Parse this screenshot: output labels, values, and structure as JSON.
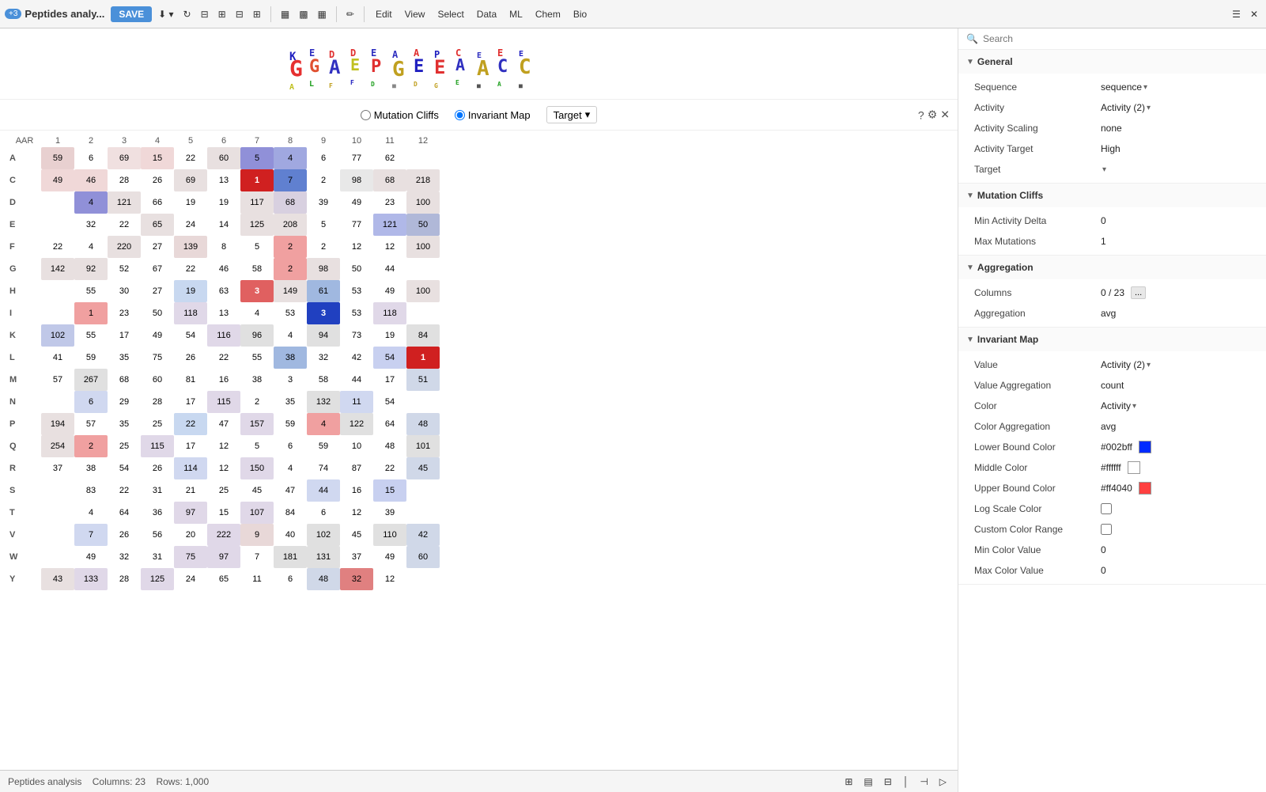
{
  "toolbar": {
    "tab_count": "+3",
    "title": "Peptides analy...",
    "save_label": "SAVE",
    "menus": [
      "Edit",
      "View",
      "Select",
      "Data",
      "ML",
      "Chem",
      "Bio"
    ]
  },
  "controls": {
    "radio_mutation": "Mutation Cliffs",
    "radio_invariant": "Invariant Map",
    "selected": "invariant",
    "target_label": "Target",
    "help_icon": "?",
    "settings_icon": "⚙",
    "close_icon": "✕"
  },
  "heatmap": {
    "col_headers": [
      "AAR",
      "1",
      "2",
      "3",
      "4",
      "5",
      "6",
      "7",
      "8",
      "9",
      "10",
      "11",
      "12"
    ],
    "rows": [
      {
        "label": "A",
        "cells": [
          "59",
          "6",
          "69",
          "15",
          "22",
          "60",
          "5",
          "4",
          "6",
          "77",
          "62",
          ""
        ]
      },
      {
        "label": "C",
        "cells": [
          "49",
          "46",
          "28",
          "26",
          "69",
          "13",
          "1",
          "7",
          "2",
          "98",
          "68",
          "218"
        ]
      },
      {
        "label": "D",
        "cells": [
          "",
          "4",
          "121",
          "66",
          "19",
          "19",
          "117",
          "68",
          "39",
          "49",
          "23",
          "100"
        ]
      },
      {
        "label": "E",
        "cells": [
          "",
          "32",
          "22",
          "65",
          "24",
          "14",
          "125",
          "208",
          "5",
          "77",
          "121",
          "50"
        ]
      },
      {
        "label": "F",
        "cells": [
          "22",
          "4",
          "220",
          "27",
          "139",
          "8",
          "5",
          "2",
          "2",
          "12",
          "12",
          "100"
        ]
      },
      {
        "label": "G",
        "cells": [
          "142",
          "92",
          "52",
          "67",
          "22",
          "46",
          "58",
          "2",
          "98",
          "50",
          "44",
          ""
        ]
      },
      {
        "label": "H",
        "cells": [
          "",
          "55",
          "30",
          "27",
          "19",
          "63",
          "3",
          "149",
          "61",
          "53",
          "49",
          "100"
        ]
      },
      {
        "label": "I",
        "cells": [
          "",
          "1",
          "23",
          "50",
          "118",
          "13",
          "4",
          "53",
          "3",
          "53",
          "118",
          ""
        ]
      },
      {
        "label": "K",
        "cells": [
          "102",
          "55",
          "17",
          "49",
          "54",
          "116",
          "96",
          "4",
          "94",
          "73",
          "19",
          "84"
        ]
      },
      {
        "label": "L",
        "cells": [
          "41",
          "59",
          "35",
          "75",
          "26",
          "22",
          "55",
          "38",
          "32",
          "42",
          "54",
          "1"
        ]
      },
      {
        "label": "M",
        "cells": [
          "57",
          "267",
          "68",
          "60",
          "81",
          "16",
          "38",
          "3",
          "58",
          "44",
          "17",
          "51"
        ]
      },
      {
        "label": "N",
        "cells": [
          "",
          "6",
          "29",
          "28",
          "17",
          "115",
          "2",
          "35",
          "132",
          "11",
          "54",
          ""
        ]
      },
      {
        "label": "P",
        "cells": [
          "194",
          "57",
          "35",
          "25",
          "22",
          "47",
          "157",
          "59",
          "4",
          "122",
          "64",
          "48"
        ]
      },
      {
        "label": "Q",
        "cells": [
          "254",
          "2",
          "25",
          "115",
          "17",
          "12",
          "5",
          "6",
          "59",
          "10",
          "48",
          "101"
        ]
      },
      {
        "label": "R",
        "cells": [
          "37",
          "38",
          "54",
          "26",
          "114",
          "12",
          "150",
          "4",
          "74",
          "87",
          "22",
          "45"
        ]
      },
      {
        "label": "S",
        "cells": [
          "",
          "83",
          "22",
          "31",
          "21",
          "25",
          "45",
          "47",
          "44",
          "16",
          "15",
          ""
        ]
      },
      {
        "label": "T",
        "cells": [
          "",
          "4",
          "64",
          "36",
          "97",
          "15",
          "107",
          "84",
          "6",
          "12",
          "39",
          ""
        ]
      },
      {
        "label": "V",
        "cells": [
          "",
          "7",
          "26",
          "56",
          "20",
          "222",
          "9",
          "40",
          "102",
          "45",
          "110",
          "42"
        ]
      },
      {
        "label": "W",
        "cells": [
          "",
          "49",
          "32",
          "31",
          "75",
          "97",
          "7",
          "181",
          "131",
          "37",
          "49",
          "60"
        ]
      },
      {
        "label": "Y",
        "cells": [
          "43",
          "133",
          "28",
          "125",
          "24",
          "65",
          "11",
          "6",
          "48",
          "32",
          "12",
          ""
        ]
      }
    ]
  },
  "status_bar": {
    "analysis": "Peptides analysis",
    "columns": "Columns: 23",
    "rows": "Rows: 1,000"
  },
  "right_panel": {
    "search_placeholder": "Search",
    "general": {
      "title": "General",
      "sequence_label": "Sequence",
      "sequence_value": "sequence",
      "activity_label": "Activity",
      "activity_value": "Activity (2)",
      "activity_scaling_label": "Activity Scaling",
      "activity_scaling_value": "none",
      "activity_target_label": "Activity Target",
      "activity_target_value": "High",
      "target_label": "Target",
      "target_value": ""
    },
    "mutation_cliffs": {
      "title": "Mutation Cliffs",
      "min_activity_delta_label": "Min Activity Delta",
      "min_activity_delta_value": "0",
      "max_mutations_label": "Max Mutations",
      "max_mutations_value": "1"
    },
    "aggregation": {
      "title": "Aggregation",
      "columns_label": "Columns",
      "columns_value": "0 / 23",
      "columns_btn": "...",
      "aggregation_label": "Aggregation",
      "aggregation_value": "avg"
    },
    "invariant_map": {
      "title": "Invariant Map",
      "value_label": "Value",
      "value_value": "Activity (2)",
      "value_aggregation_label": "Value Aggregation",
      "value_aggregation_value": "count",
      "color_label": "Color",
      "color_value": "Activity",
      "color_aggregation_label": "Color Aggregation",
      "color_aggregation_value": "avg",
      "lower_bound_label": "Lower Bound Color",
      "lower_bound_value": "#002bff",
      "lower_bound_hex": "#002bff",
      "middle_color_label": "Middle Color",
      "middle_color_value": "#ffffff",
      "middle_color_hex": "#ffffff",
      "upper_bound_label": "Upper Bound Color",
      "upper_bound_value": "#ff4040",
      "upper_bound_hex": "#ff4040",
      "log_scale_label": "Log Scale Color",
      "custom_range_label": "Custom Color Range",
      "min_color_label": "Min Color Value",
      "min_color_value": "0",
      "max_color_label": "Max Color Value",
      "max_color_value": "0"
    }
  }
}
